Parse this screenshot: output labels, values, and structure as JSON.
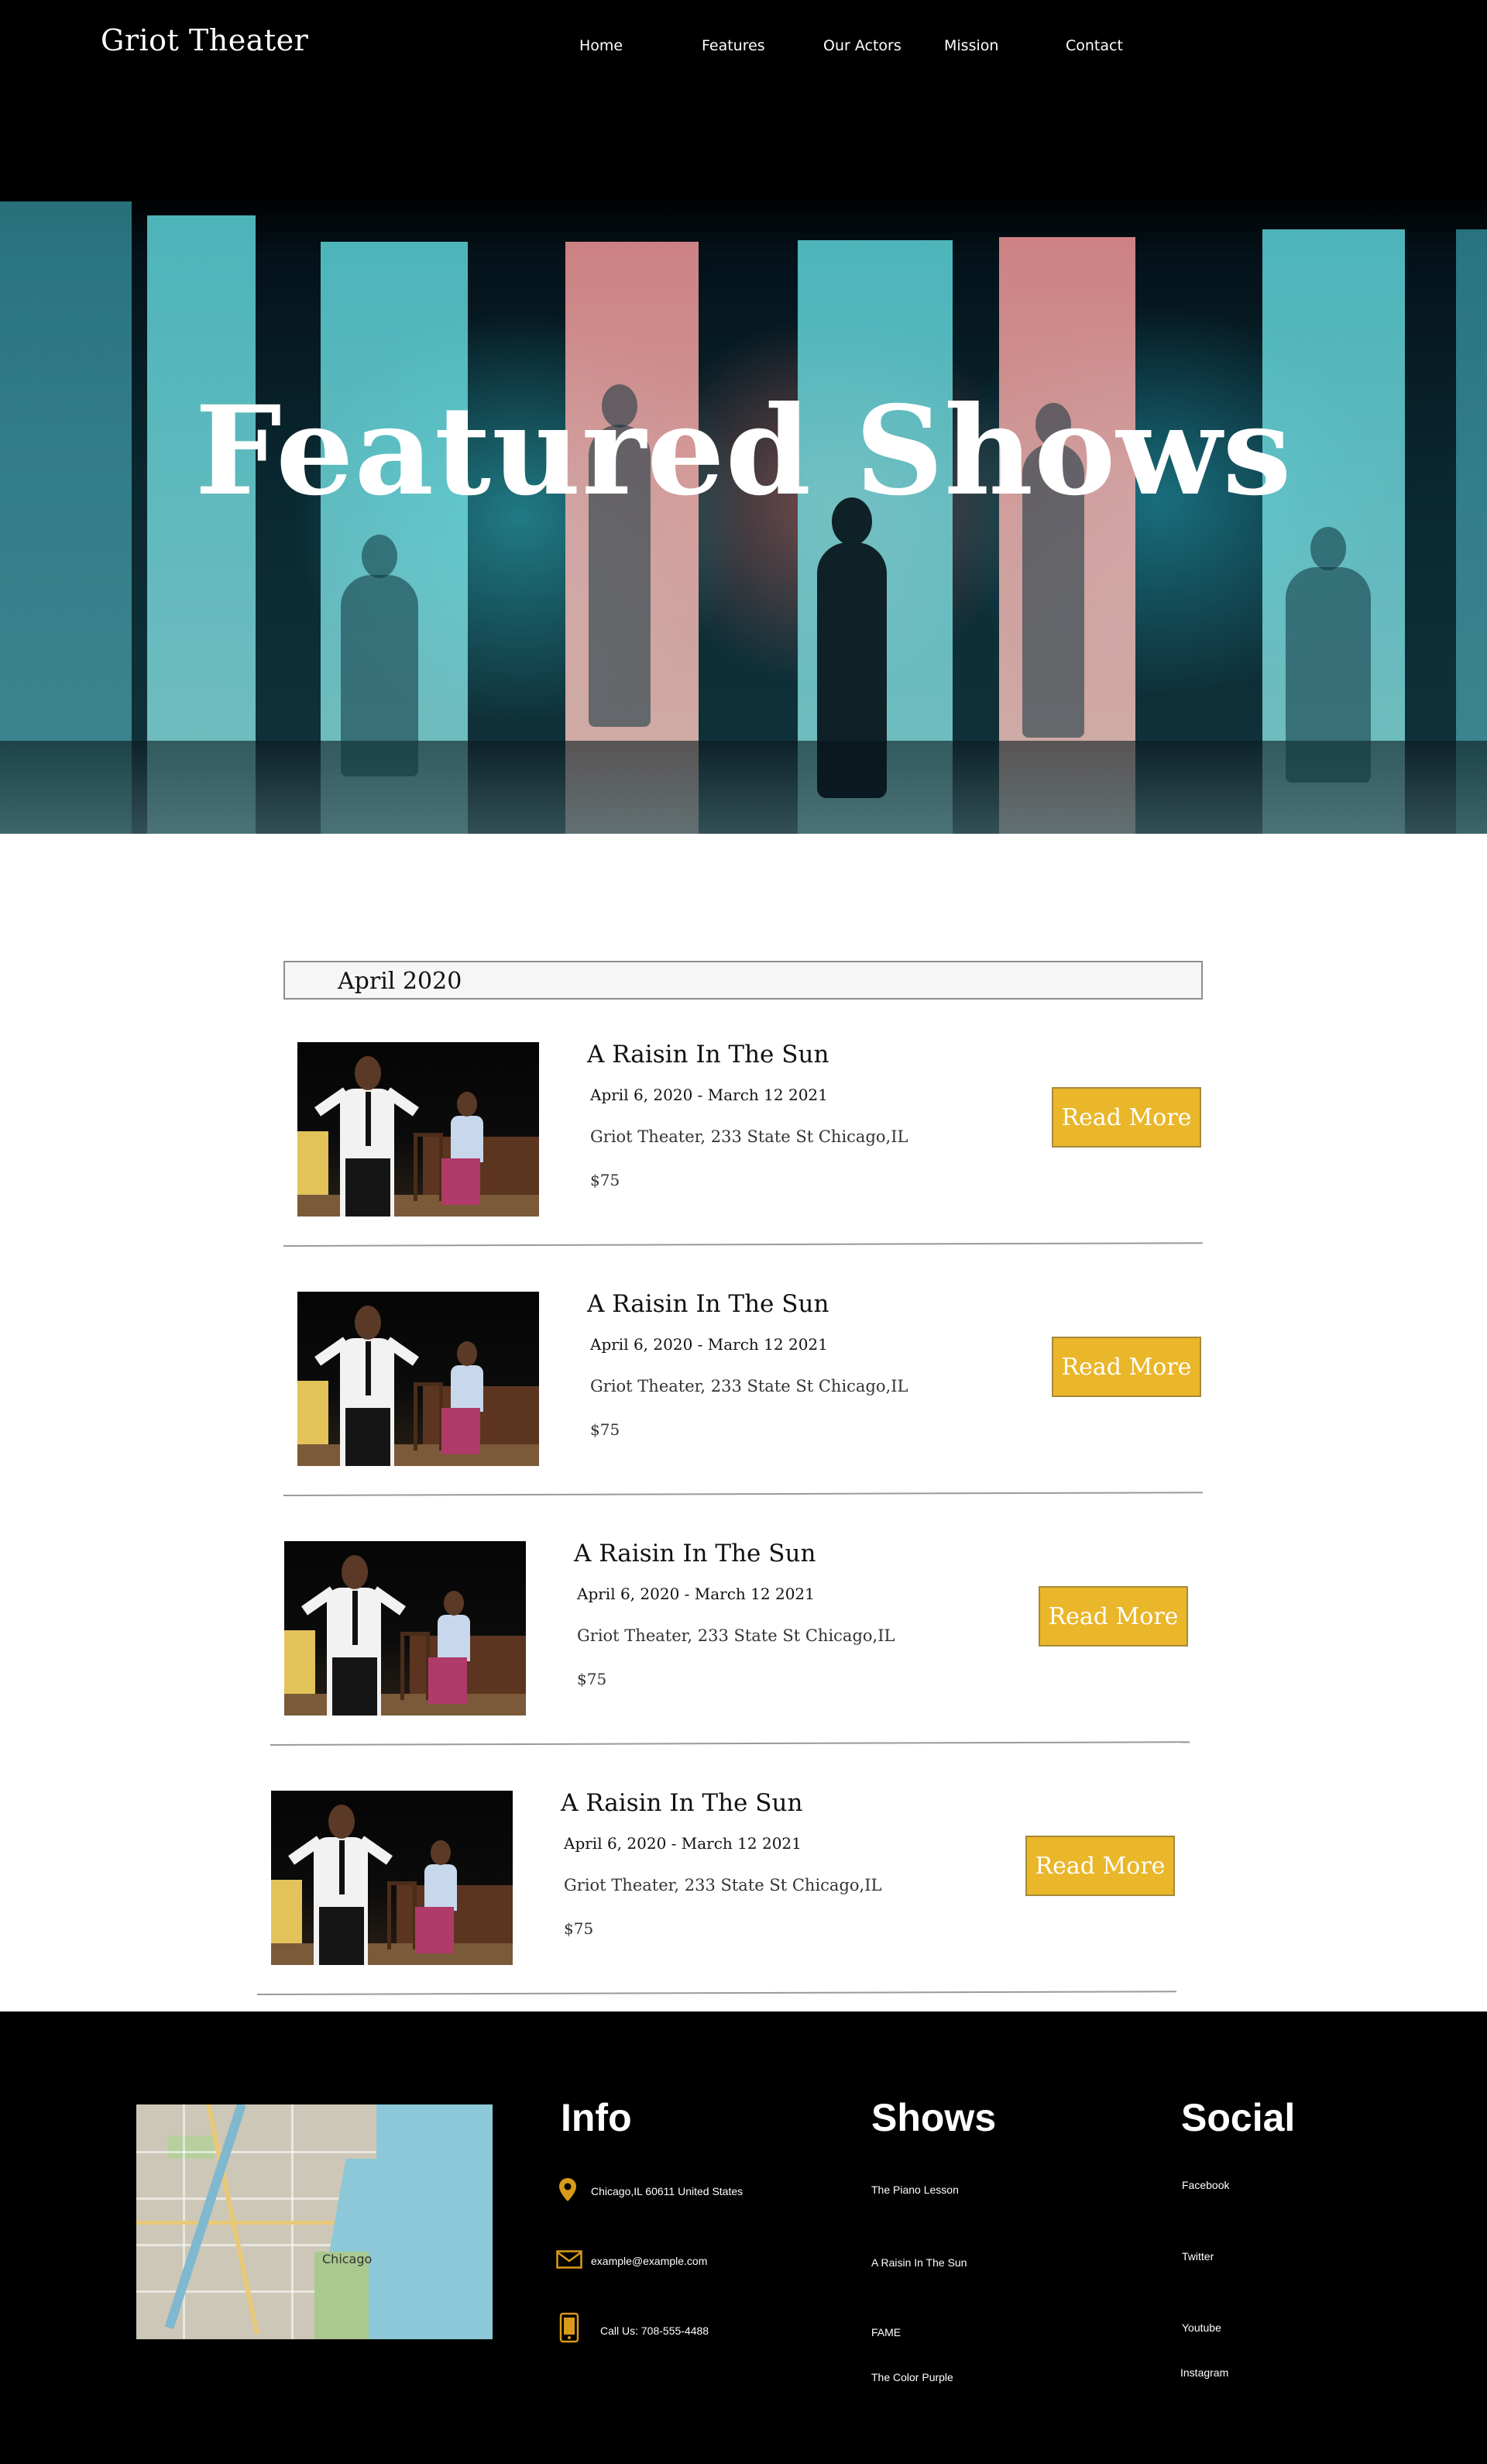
{
  "header": {
    "logo": "Griot Theater",
    "nav": [
      "Home",
      "Features",
      "Our Actors",
      "Mission",
      "Contact"
    ]
  },
  "hero": {
    "title": "Featured Shows"
  },
  "shows_section": {
    "month": "April 2020",
    "read_more_label": "Read More",
    "shows": [
      {
        "title": "A Raisin In The Sun",
        "dates": "April 6, 2020 - March 12 2021",
        "venue": "Griot Theater, 233 State St Chicago,IL",
        "price": "$75"
      },
      {
        "title": "A Raisin In The Sun",
        "dates": "April 6, 2020 - March 12 2021",
        "venue": "Griot Theater, 233 State St Chicago,IL",
        "price": "$75"
      },
      {
        "title": "A Raisin In The Sun",
        "dates": "April 6, 2020 - March 12 2021",
        "venue": "Griot Theater, 233 State St Chicago,IL",
        "price": "$75"
      },
      {
        "title": "A Raisin In The Sun",
        "dates": "April 6, 2020 - March 12 2021",
        "venue": "Griot Theater, 233 State St Chicago,IL",
        "price": "$75"
      }
    ]
  },
  "footer": {
    "map_label": "Chicago",
    "info": {
      "heading": "Info",
      "address": "Chicago,IL 60611 United States",
      "email": "example@example.com",
      "phone": "Call Us: 708-555-4488"
    },
    "shows": {
      "heading": "Shows",
      "items": [
        "The Piano Lesson",
        "A Raisin In The Sun",
        "FAME",
        "The Color Purple"
      ]
    },
    "social": {
      "heading": "Social",
      "items": [
        "Facebook",
        "Twitter",
        "Youtube",
        "Instagram"
      ]
    }
  },
  "colors": {
    "accent": "#eab62a",
    "footer_bg": "#000000",
    "icon": "#d99a1a"
  },
  "icons": [
    "location-pin-icon",
    "mail-icon",
    "phone-icon"
  ]
}
